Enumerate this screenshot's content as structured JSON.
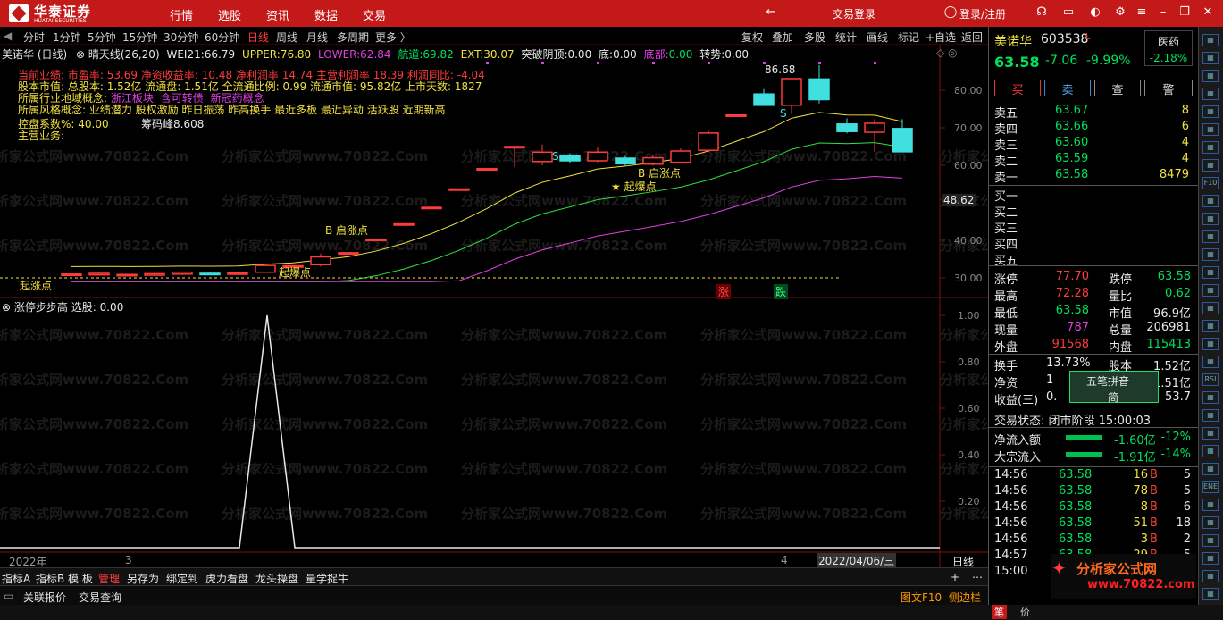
{
  "title_bar": {
    "logo_cn": "华泰证券",
    "logo_en": "HUATAI SECURITIES",
    "menu": [
      "行情",
      "选股",
      "资讯",
      "数据",
      "交易"
    ],
    "trade_login": "交易登录",
    "login": "登录/注册"
  },
  "toolbar": {
    "periods": [
      "分时",
      "1分钟",
      "5分钟",
      "15分钟",
      "30分钟",
      "60分钟",
      "日线",
      "周线",
      "月线",
      "多周期",
      "更多 〉"
    ],
    "actions": [
      "复权",
      "叠加",
      "多股",
      "统计",
      "画线",
      "标记",
      "+自选",
      "返回"
    ]
  },
  "chart_header": {
    "name": "美诺华 (日线)",
    "indicator": "晴天线(26,20)",
    "wei21_label": "WEI21:",
    "wei21": "66.79",
    "upper_label": "UPPER:",
    "upper": "76.80",
    "lower_label": "LOWER:",
    "lower": "62.84",
    "hangdao_label": "航道:",
    "hangdao": "69.82",
    "ext_label": "EXT:",
    "ext": "30.07",
    "tupo_label": "突破阴顶:",
    "tupo": "0.00",
    "di_label": "底:",
    "di": "0.00",
    "dibu_label": "底部:",
    "dibu": "0.00",
    "zhuanshi_label": "转势:",
    "zhuanshi": "0.00"
  },
  "info": {
    "line1": "当前业绩: 市盈率: 53.69 净资收益率: 10.48 净利润率 14.74 主营利润率 18.39 利润同比: -4.04",
    "line2": "股本市值: 总股本: 1.52亿 流通盘: 1.51亿 全流通比例: 0.99 流通市值: 95.82亿 上市天数: 1827",
    "line3_label": "所属行业地域概念:",
    "line3_a": "浙江板块",
    "line3_b": "含可转债",
    "line3_c": "新冠药概念",
    "line4": "所属风格概念: 业绩潜力 股权激励 昨日振荡 昨高换手 最近多板 最近异动 活跃股 近期新高",
    "line5": "控盘系数%: 40.00",
    "chips": "筹码峰8.608",
    "line6": "主营业务:"
  },
  "chart_labels": {
    "high": "86.68",
    "b_start1": "B 启涨点",
    "star1": "★ 起爆点",
    "b_start2": "B 启涨点",
    "star2": "起爆点",
    "s1": "S",
    "s2": "S",
    "zhang": "涨",
    "die": "跌",
    "bottom_label": "起涨点",
    "price_tag": "48.62"
  },
  "chart_data": {
    "type": "candlestick",
    "price_axis": [
      "80.00",
      "70.00",
      "60.00",
      "40.00",
      "30.00"
    ],
    "candles": [
      {
        "o": 31.0,
        "c": 31.0,
        "h": 31.0,
        "l": 31.0
      },
      {
        "o": 30.8,
        "c": 31.2,
        "h": 31.4,
        "l": 30.6
      },
      {
        "o": 30.9,
        "c": 30.9,
        "h": 31.1,
        "l": 30.7
      },
      {
        "o": 30.7,
        "c": 31.1,
        "h": 31.3,
        "l": 30.5
      },
      {
        "o": 31.0,
        "c": 31.5,
        "h": 31.7,
        "l": 30.8
      },
      {
        "o": 31.2,
        "c": 31.0,
        "h": 31.4,
        "l": 30.9
      },
      {
        "o": 31.0,
        "c": 31.3,
        "h": 31.5,
        "l": 30.8
      },
      {
        "o": 31.5,
        "c": 33.3,
        "h": 33.3,
        "l": 31.4
      },
      {
        "o": 33.0,
        "c": 33.2,
        "h": 33.2,
        "l": 32.8
      },
      {
        "o": 33.5,
        "c": 35.6,
        "h": 36.5,
        "l": 33.0
      },
      {
        "o": 36.7,
        "c": 36.7,
        "h": 36.7,
        "l": 36.7
      },
      {
        "o": 40.3,
        "c": 40.3,
        "h": 40.3,
        "l": 40.3
      },
      {
        "o": 44.4,
        "c": 44.4,
        "h": 44.4,
        "l": 44.4
      },
      {
        "o": 48.8,
        "c": 48.8,
        "h": 48.8,
        "l": 48.8
      },
      {
        "o": 53.7,
        "c": 53.7,
        "h": 53.7,
        "l": 53.7
      },
      {
        "o": 59.1,
        "c": 59.1,
        "h": 59.1,
        "l": 59.1
      },
      {
        "o": 65.0,
        "c": 65.0,
        "h": 65.0,
        "l": 59.5
      },
      {
        "o": 61.0,
        "c": 63.5,
        "h": 65.5,
        "l": 60.0
      },
      {
        "o": 62.6,
        "c": 61.2,
        "h": 63.2,
        "l": 60.5
      },
      {
        "o": 61.2,
        "c": 63.5,
        "h": 64.8,
        "l": 60.8
      },
      {
        "o": 61.9,
        "c": 60.4,
        "h": 62.5,
        "l": 59.8
      },
      {
        "o": 60.3,
        "c": 62.0,
        "h": 62.8,
        "l": 59.9
      },
      {
        "o": 60.8,
        "c": 63.8,
        "h": 64.5,
        "l": 60.5
      },
      {
        "o": 64.0,
        "c": 68.6,
        "h": 69.5,
        "l": 63.5
      },
      {
        "o": 73.4,
        "c": 73.4,
        "h": 73.4,
        "l": 73.4
      },
      {
        "o": 79.0,
        "c": 76.0,
        "h": 80.3,
        "l": 75.8
      },
      {
        "o": 76.0,
        "c": 83.1,
        "h": 83.3,
        "l": 73.7
      },
      {
        "o": 83.0,
        "c": 77.5,
        "h": 86.7,
        "l": 76.5
      },
      {
        "o": 71.0,
        "c": 69.0,
        "h": 72.5,
        "l": 68.5
      },
      {
        "o": 68.8,
        "c": 71.2,
        "h": 72.3,
        "l": 63.6
      },
      {
        "o": 69.8,
        "c": 63.6,
        "h": 72.3,
        "l": 63.6
      }
    ],
    "lower_panel": {
      "name": "涨停步步高",
      "label": "选股:",
      "value": "0.00",
      "axis": [
        "1.00",
        "0.80",
        "0.60",
        "0.40",
        "0.20"
      ]
    },
    "date_left": "2022年",
    "date_right": "2022/04/06/三",
    "period_label": "日线",
    "marker_3": "3",
    "marker_4": "4"
  },
  "bottom_tabs": [
    "指标A",
    "指标B",
    "模 板",
    "管理",
    "另存为",
    "绑定到",
    "虎力看盘",
    "龙头操盘",
    "量学捉牛"
  ],
  "status_bar": {
    "items": [
      "关联报价",
      "交易查询"
    ],
    "f10": "图文F10",
    "side": "侧边栏",
    "pen": "笔",
    "price": "价"
  },
  "stock": {
    "name": "美诺华",
    "code": "603538",
    "flag": "L",
    "sector": "医药",
    "sector_change": "-2.18%",
    "price": "63.58",
    "change": "-7.06",
    "change_pct": "-9.99%",
    "actions": [
      "买",
      "卖",
      "查",
      "警"
    ]
  },
  "order_book": {
    "sells": [
      {
        "label": "卖五",
        "price": "63.67",
        "vol": "8"
      },
      {
        "label": "卖四",
        "price": "63.66",
        "vol": "6"
      },
      {
        "label": "卖三",
        "price": "63.60",
        "vol": "4"
      },
      {
        "label": "卖二",
        "price": "63.59",
        "vol": "4"
      },
      {
        "label": "卖一",
        "price": "63.58",
        "vol": "8479"
      }
    ],
    "buys": [
      "买一",
      "买二",
      "买三",
      "买四",
      "买五"
    ]
  },
  "quote": [
    {
      "l1": "涨停",
      "v1": "77.70",
      "l2": "跌停",
      "v2": "63.58"
    },
    {
      "l1": "最高",
      "v1": "72.28",
      "l2": "量比",
      "v2": "0.62"
    },
    {
      "l1": "最低",
      "v1": "63.58",
      "l2": "市值",
      "v2": "96.9亿"
    },
    {
      "l1": "现量",
      "v1": "787",
      "l2": "总量",
      "v2": "206981"
    },
    {
      "l1": "外盘",
      "v1": "91568",
      "l2": "内盘",
      "v2": "115413"
    }
  ],
  "quote2": [
    {
      "l1": "换手",
      "v1": "13.73%",
      "l2": "股本",
      "v2": "1.52亿"
    },
    {
      "l1": "净资",
      "v1": "1",
      "l2": "",
      "v2": "1.51亿"
    },
    {
      "l1": "收益(三)",
      "v1": "0.",
      "l2": "",
      "v2": "53.7"
    }
  ],
  "ime": {
    "line1": "五笔拼音",
    "line2": "简"
  },
  "trade_status": "交易状态: 闭市阶段 15:00:03",
  "flows": [
    {
      "label": "净流入额",
      "value": "-1.60亿",
      "pct": "-12%"
    },
    {
      "label": "大宗流入",
      "value": "-1.91亿",
      "pct": "-14%"
    }
  ],
  "ticks": [
    {
      "time": "14:56",
      "price": "63.58",
      "vol": "16",
      "side": "B",
      "n": "5"
    },
    {
      "time": "14:56",
      "price": "63.58",
      "vol": "78",
      "side": "B",
      "n": "5"
    },
    {
      "time": "14:56",
      "price": "63.58",
      "vol": "8",
      "side": "B",
      "n": "6"
    },
    {
      "time": "14:56",
      "price": "63.58",
      "vol": "51",
      "side": "B",
      "n": "18"
    },
    {
      "time": "14:56",
      "price": "63.58",
      "vol": "3",
      "side": "B",
      "n": "2"
    },
    {
      "time": "14:57",
      "price": "63.58",
      "vol": "29",
      "side": "B",
      "n": "5"
    },
    {
      "time": "15:00",
      "price": "",
      "vol": "",
      "side": "",
      "n": ""
    }
  ],
  "watermark": "分析家公式网www.70822.Com",
  "brand": {
    "cn": "分析家公式网",
    "url": "www.70822.com"
  },
  "sidebar": [
    "F10",
    "RSI",
    "ENE"
  ],
  "colors": {
    "up": "#ff3b3b",
    "down": "#40e0e0",
    "yellow": "#f0e040",
    "green": "#00e05a",
    "magenta": "#e040e0",
    "title": "#c41919"
  }
}
